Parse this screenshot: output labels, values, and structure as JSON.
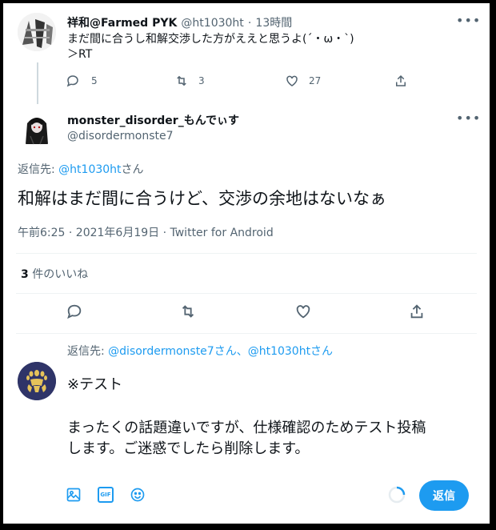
{
  "parent_tweet": {
    "display_name": "祥和@Farmed PYK",
    "handle": "@ht1030ht",
    "separator": "·",
    "time": "13時間",
    "text_line1": "まだ間に合うし和解交渉した方がええと思うよ(´・ω・`)",
    "text_line2": "＞RT",
    "reply_count": "5",
    "retweet_count": "3",
    "like_count": "27"
  },
  "main_tweet": {
    "display_name": "monster_disorder_もんでぃす",
    "handle": "@disordermonste7",
    "reply_to_prefix": "返信先: ",
    "reply_to_handle": "@ht1030ht",
    "reply_to_suffix": "さん",
    "text": "和解はまだ間に合うけど、交渉の余地はないなぁ",
    "timestamp": "午前6:25 · 2021年6月19日 · ",
    "client": "Twitter for Android",
    "likes_count": "3",
    "likes_label": " 件のいいね"
  },
  "composer": {
    "reply_to_prefix": "返信先: ",
    "reply_to_handles": "@disordermonste7さん、@ht1030htさん",
    "text_line1": "※テスト",
    "text_line2": "まったくの話題違いですが、仕様確認のためテスト投稿",
    "text_line3": "します。ご迷惑でしたら削除します。",
    "gif_label": "GIF",
    "reply_button": "返信"
  },
  "colors": {
    "accent": "#1d9bf0",
    "muted": "#536471",
    "divider": "#eff3f4"
  }
}
